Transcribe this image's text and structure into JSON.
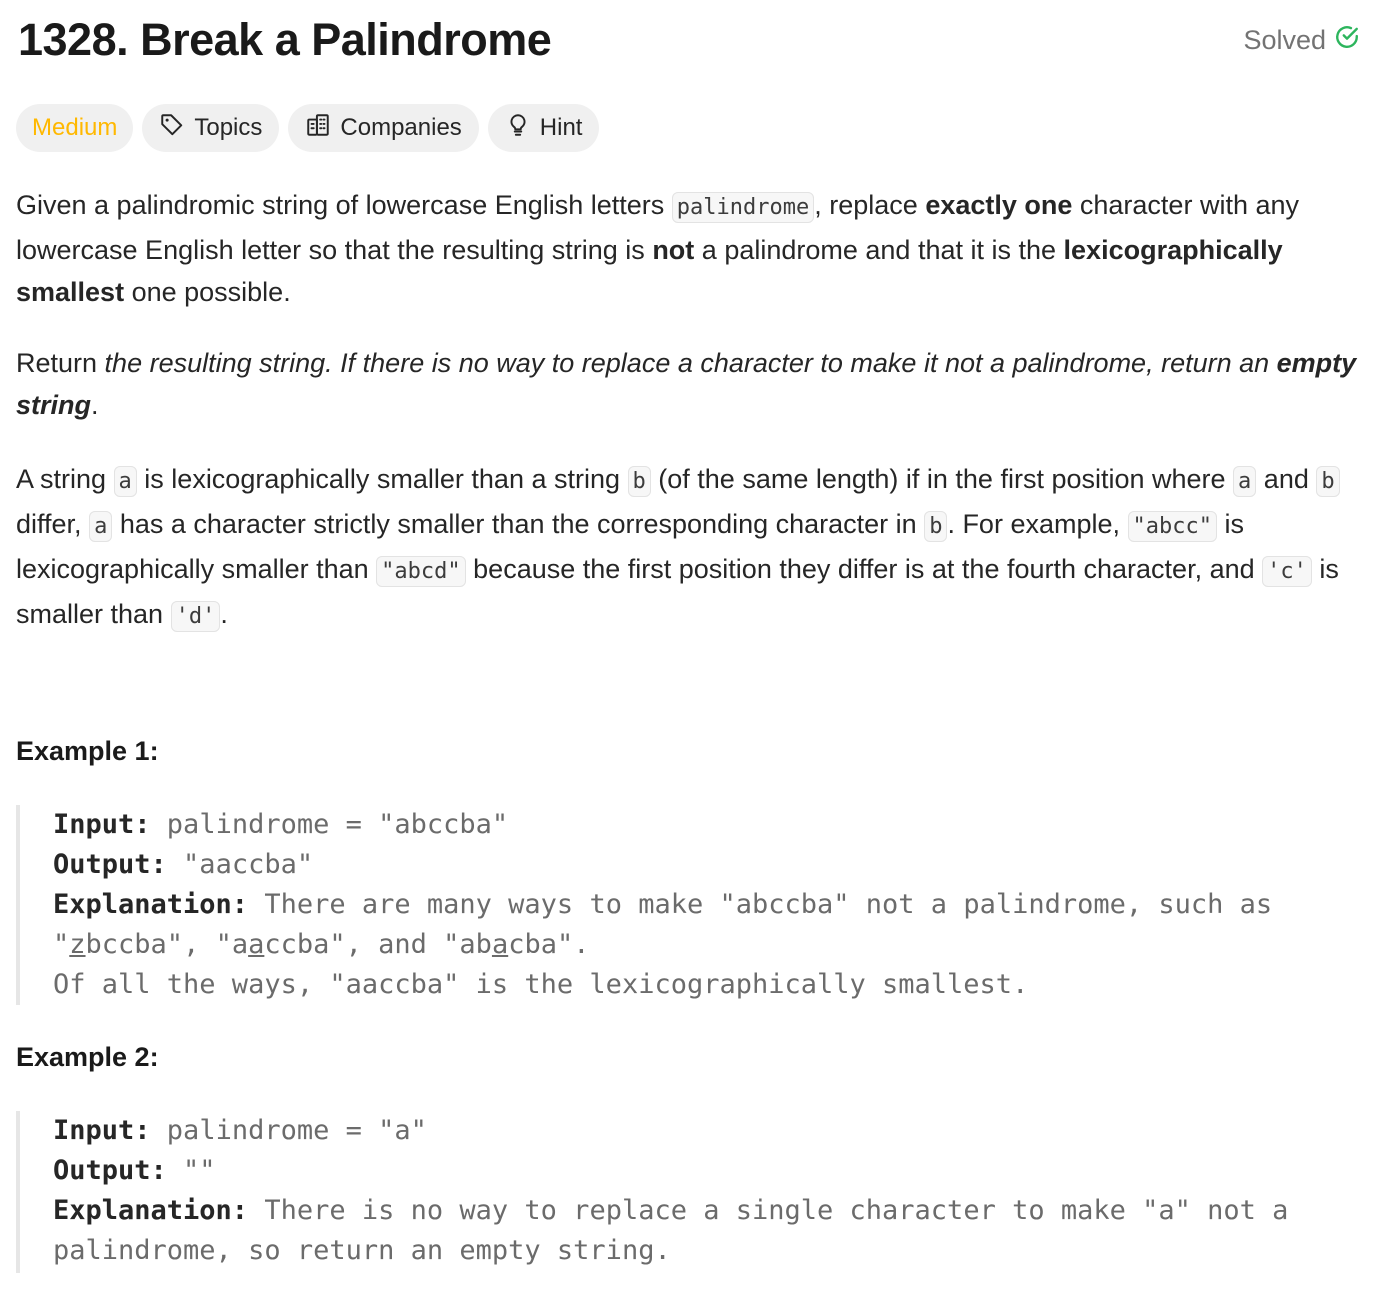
{
  "problem": {
    "title": "1328. Break a Palindrome",
    "status": "Solved"
  },
  "tags": {
    "difficulty": "Medium",
    "topics": "Topics",
    "companies": "Companies",
    "hint": "Hint"
  },
  "colors": {
    "difficulty": "#ffb800",
    "solved_check": "#2db55d"
  },
  "icons": {
    "solved": "check-circle-icon",
    "topics": "tag-icon",
    "companies": "building-icon",
    "hint": "lightbulb-icon"
  },
  "description": {
    "p1": {
      "t1": "Given a palindromic string of lowercase English letters ",
      "code1": "palindrome",
      "t2": ", replace ",
      "b1": "exactly one",
      "t3": " character with any lowercase English letter so that the resulting string is ",
      "b2": "not",
      "t4": " a palindrome and that it is the ",
      "b3": "lexicographically smallest",
      "t5": " one possible."
    },
    "p2": {
      "t1": "Return ",
      "i1": "the resulting string. If there is no way to replace a character to make it not a palindrome, return an ",
      "bi1": "empty string",
      "t2": "."
    },
    "p3": {
      "t1": "A string ",
      "c1": "a",
      "t2": " is lexicographically smaller than a string ",
      "c2": "b",
      "t3": " (of the same length) if in the first position where ",
      "c3": "a",
      "t4": " and ",
      "c4": "b",
      "t5": " differ, ",
      "c5": "a",
      "t6": " has a character strictly smaller than the corresponding character in ",
      "c6": "b",
      "t7": ". For example, ",
      "c7": "\"abcc\"",
      "t8": " is lexicographically smaller than ",
      "c8": "\"abcd\"",
      "t9": " because the first position they differ is at the fourth character, and ",
      "c9": "'c'",
      "t10": " is smaller than ",
      "c10": "'d'",
      "t11": "."
    }
  },
  "examples": [
    {
      "title": "Example 1:",
      "input_label": "Input:",
      "input_value": " palindrome = \"abccba\"",
      "output_label": "Output:",
      "output_value": " \"aaccba\"",
      "explanation_label": "Explanation:",
      "explanation_a": " There are many ways to make \"abccba\" not a palindrome, such as \"",
      "u1": "z",
      "explanation_b": "bccba\", \"a",
      "u2": "a",
      "explanation_c": "ccba\", and \"ab",
      "u3": "a",
      "explanation_d": "cba\".",
      "explanation_line2": "Of all the ways, \"aaccba\" is the lexicographically smallest."
    },
    {
      "title": "Example 2:",
      "input_label": "Input:",
      "input_value": " palindrome = \"a\"",
      "output_label": "Output:",
      "output_value": " \"\"",
      "explanation_label": "Explanation:",
      "explanation_text": " There is no way to replace a single character to make \"a\" not a palindrome, so return an empty string."
    }
  ]
}
